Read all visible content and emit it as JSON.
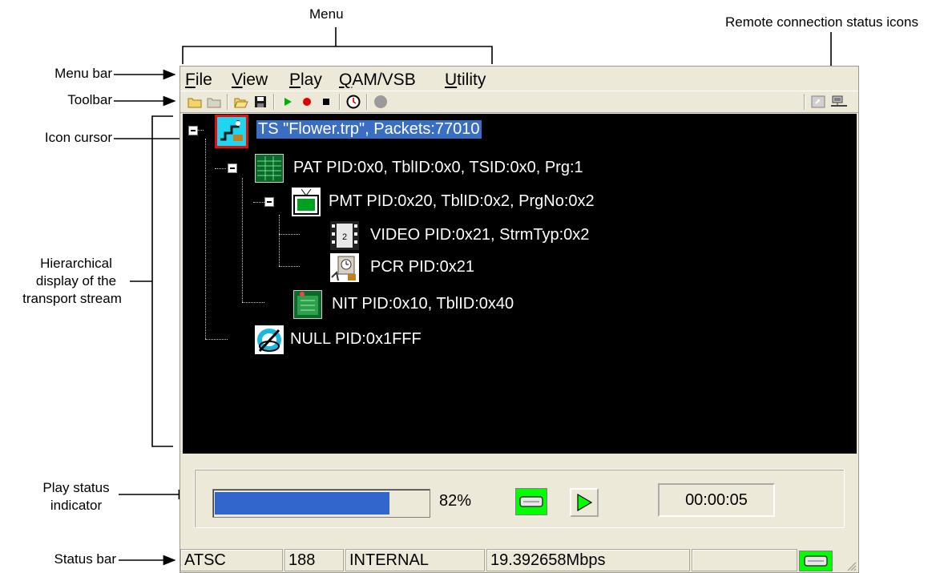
{
  "annotations": {
    "menu": "Menu",
    "remote_icons": "Remote connection status icons",
    "menu_bar": "Menu bar",
    "toolbar": "Toolbar",
    "icon_cursor": "Icon cursor",
    "hier_1": "Hierarchical",
    "hier_2": "display of the",
    "hier_3": "transport stream",
    "play_1": "Play status",
    "play_2": "indicator",
    "status_bar": "Status bar"
  },
  "menu": [
    "File",
    "View",
    "Play",
    "QAM/VSB",
    "Utility"
  ],
  "toolbar_icons": [
    "new-folder-icon",
    "folder-icon",
    "open-icon",
    "save-icon",
    "play-icon",
    "record-icon",
    "stop-icon",
    "timer-icon",
    "disabled-circle-icon"
  ],
  "remote_icons": [
    "remote-connect-icon",
    "network-icon"
  ],
  "tree": {
    "ts": "TS \"Flower.trp\", Packets:77010",
    "pat": "PAT PID:0x0, TblID:0x0, TSID:0x0, Prg:1",
    "pmt": "PMT PID:0x20, TblID:0x2, PrgNo:0x2",
    "video": "VIDEO PID:0x21, StrmTyp:0x2",
    "pcr": "PCR PID:0x21",
    "nit": "NIT PID:0x10, TblID:0x40",
    "null": "NULL PID:0x1FFF"
  },
  "play": {
    "progress_percent": 82,
    "percent_label": "82%",
    "time": "00:00:05"
  },
  "status": {
    "standard": "ATSC",
    "packet_size": "188",
    "source": "INTERNAL",
    "rate": "19.392658Mbps",
    "empty": ""
  },
  "colors": {
    "tree_bg": "#000000",
    "selection": "#3a6ec4",
    "progress": "#3366cc",
    "indicator_green": "#00ff00",
    "cursor_red": "#e01010"
  }
}
